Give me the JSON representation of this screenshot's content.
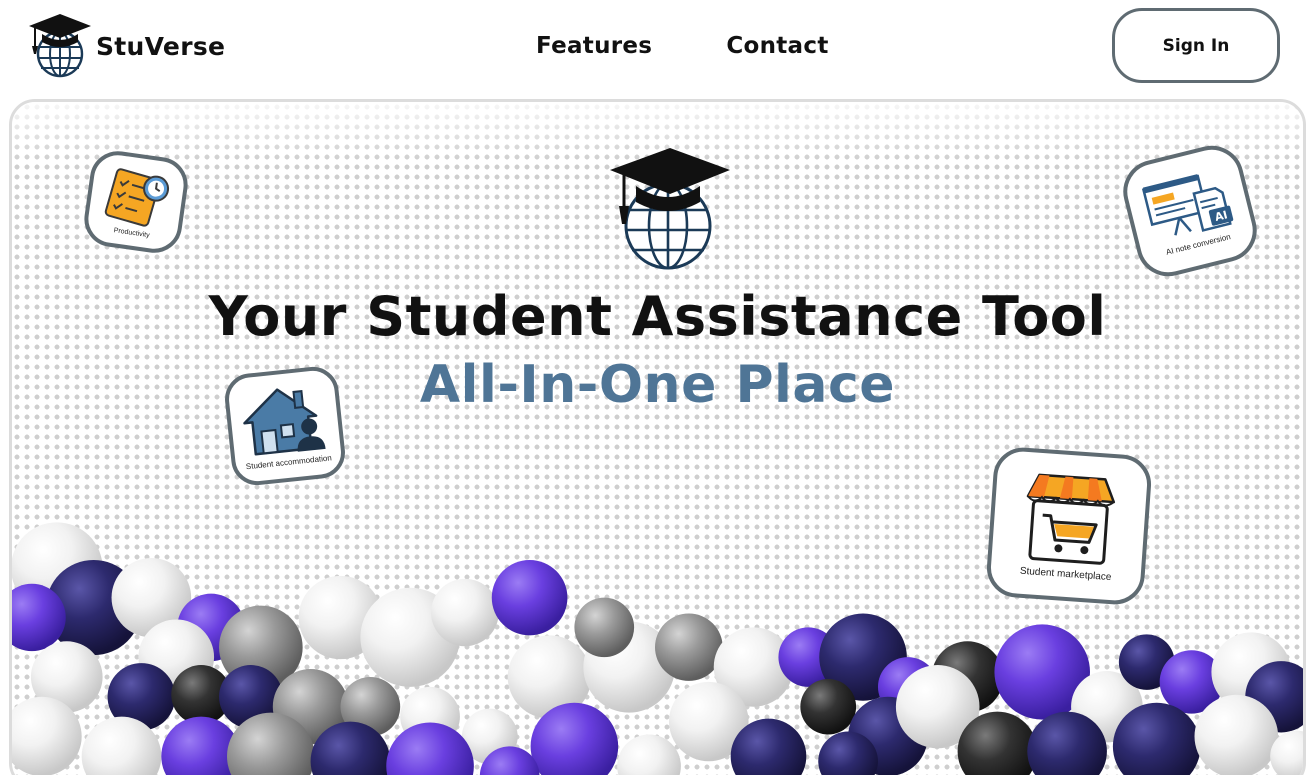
{
  "brand": {
    "name": "StuVerse",
    "logo_icon": "graduation-cap-globe-icon"
  },
  "nav": {
    "links": [
      {
        "label": "Features"
      },
      {
        "label": "Contact"
      }
    ]
  },
  "auth": {
    "sign_in_label": "Sign In"
  },
  "hero": {
    "logo_icon": "graduation-cap-globe-icon",
    "title": "Your Student Assistance Tool",
    "subtitle": "All-In-One Place",
    "feature_cards": [
      {
        "label": "Productivity",
        "icon": "checklist-clock-icon"
      },
      {
        "label": "AI note conversion",
        "icon": "presentation-ai-icon"
      },
      {
        "label": "Student accommodation",
        "icon": "house-person-icon"
      },
      {
        "label": "Student marketplace",
        "icon": "shop-cart-icon"
      }
    ]
  },
  "colors": {
    "accent_blue": "#4f7596",
    "card_border": "#5f6b72",
    "ball_purple": "#6a3fe0",
    "ball_navy": "#2d2a6e",
    "ball_white": "#f2f2f2",
    "ball_gray": "#9a9a9a",
    "ball_dark": "#333333"
  }
}
